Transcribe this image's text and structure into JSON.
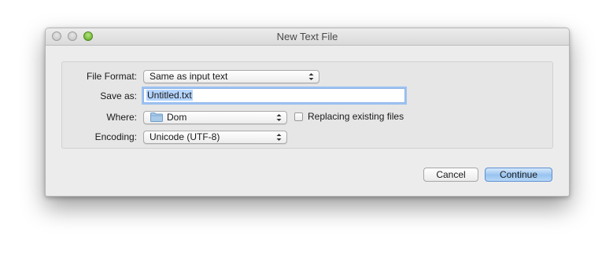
{
  "window": {
    "title": "New Text File"
  },
  "form": {
    "file_format": {
      "label": "File Format:",
      "value": "Same as input text"
    },
    "save_as": {
      "label": "Save as:",
      "value": "Untitled.txt"
    },
    "where": {
      "label": "Where:",
      "value": "Dom",
      "icon": "folder-icon"
    },
    "replacing": {
      "label": "Replacing existing files",
      "checked": false
    },
    "encoding": {
      "label": "Encoding:",
      "value": "Unicode (UTF-8)"
    }
  },
  "buttons": {
    "cancel": "Cancel",
    "continue": "Continue"
  },
  "colors": {
    "accent": "#98c3f0",
    "focus_ring": "#9cc3f2",
    "zoom_button": "#5aa523"
  }
}
